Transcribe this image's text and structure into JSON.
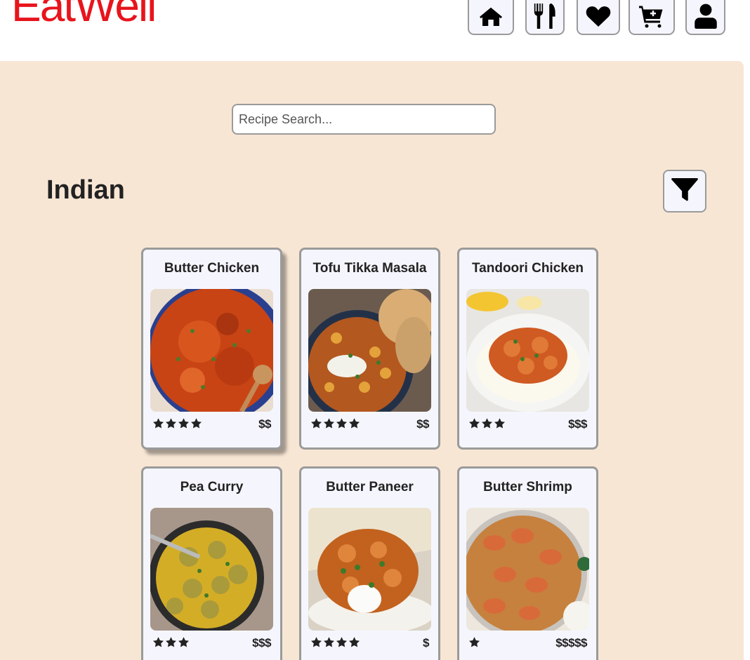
{
  "app": {
    "logo": "EatWell"
  },
  "nav": {
    "items": [
      {
        "id": "home",
        "icon": "home-icon"
      },
      {
        "id": "recipes",
        "icon": "utensils-icon"
      },
      {
        "id": "favorites",
        "icon": "heart-icon"
      },
      {
        "id": "cart",
        "icon": "cart-plus-icon"
      },
      {
        "id": "profile",
        "icon": "user-icon"
      }
    ]
  },
  "search": {
    "placeholder": "Recipe Search..."
  },
  "category": {
    "title": "Indian",
    "filter_icon": "filter-icon"
  },
  "colors": {
    "brand": "#e8141c",
    "panel": "#f8e6d4",
    "card": "#f5f6fd",
    "border": "#9a9a9a"
  },
  "recipes": [
    {
      "name": "Butter Chicken",
      "rating": 4,
      "price": "$$"
    },
    {
      "name": "Tofu Tikka Masala",
      "rating": 4,
      "price": "$$"
    },
    {
      "name": "Tandoori Chicken",
      "rating": 3,
      "price": "$$$"
    },
    {
      "name": "Pea Curry",
      "rating": 3,
      "price": "$$$"
    },
    {
      "name": "Butter Paneer",
      "rating": 4,
      "price": "$"
    },
    {
      "name": "Butter Shrimp",
      "rating": 1,
      "price": "$$$$$"
    }
  ]
}
